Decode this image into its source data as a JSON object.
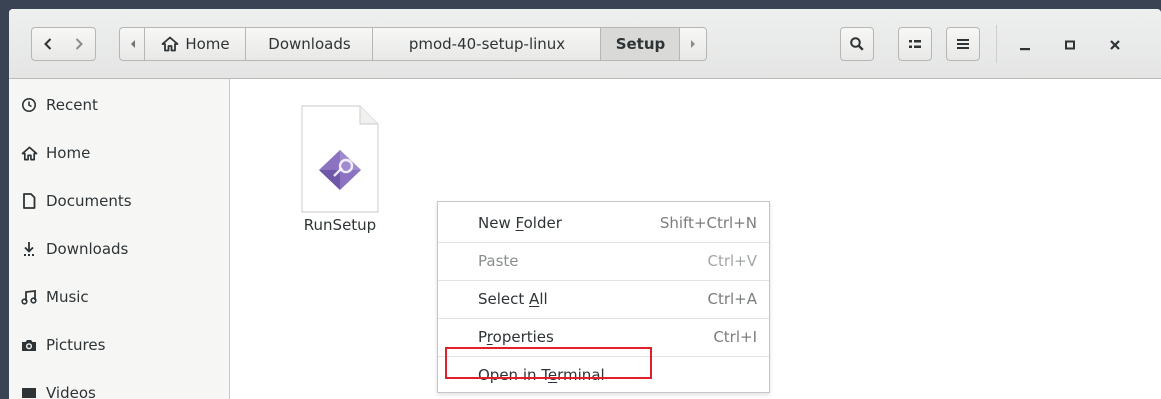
{
  "header": {
    "breadcrumbs": [
      {
        "label": "Home",
        "icon": "home-icon",
        "active": false
      },
      {
        "label": "Downloads",
        "active": false
      },
      {
        "label": "pmod-40-setup-linux",
        "active": false
      },
      {
        "label": "Setup",
        "active": true
      }
    ],
    "back_icon": "chevron-left-icon",
    "forward_icon": "chevron-right-icon",
    "search_icon": "search-icon",
    "view_icon": "list-view-icon",
    "menu_icon": "hamburger-menu-icon",
    "window_controls": [
      "minimize-icon",
      "maximize-icon",
      "close-icon"
    ]
  },
  "sidebar": {
    "items": [
      {
        "label": "Recent",
        "icon": "clock-icon"
      },
      {
        "label": "Home",
        "icon": "home-icon"
      },
      {
        "label": "Documents",
        "icon": "document-icon"
      },
      {
        "label": "Downloads",
        "icon": "download-icon"
      },
      {
        "label": "Music",
        "icon": "music-icon"
      },
      {
        "label": "Pictures",
        "icon": "camera-icon"
      },
      {
        "label": "Videos",
        "icon": "video-icon"
      }
    ]
  },
  "files": [
    {
      "name": "RunSetup",
      "icon": "executable-file-icon"
    }
  ],
  "context_menu": {
    "items": [
      {
        "pre": "New ",
        "mnemonic": "F",
        "post": "older",
        "accel": "Shift+Ctrl+N",
        "enabled": true
      },
      {
        "pre": "Paste",
        "mnemonic": "",
        "post": "",
        "accel": "Ctrl+V",
        "enabled": false
      },
      {
        "pre": "Select ",
        "mnemonic": "A",
        "post": "ll",
        "accel": "Ctrl+A",
        "enabled": true
      },
      {
        "pre": "P",
        "mnemonic": "r",
        "post": "operties",
        "accel": "Ctrl+I",
        "enabled": true
      },
      {
        "pre": "Open in T",
        "mnemonic": "e",
        "post": "rminal",
        "accel": "",
        "enabled": true
      }
    ]
  },
  "colors": {
    "highlight_box": "#e0202a",
    "active_crumb_bg": "#d9dad8",
    "sidebar_bg": "#f6f6f5"
  }
}
